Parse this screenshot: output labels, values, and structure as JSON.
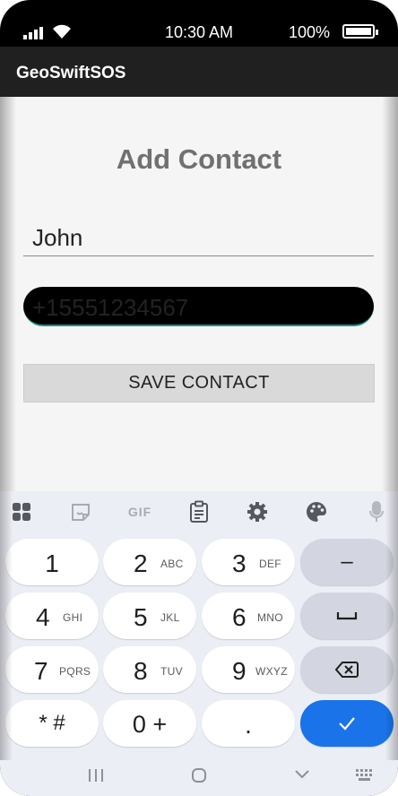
{
  "status_bar": {
    "time": "10:30 AM",
    "battery": "100%"
  },
  "app_bar": {
    "title": "GeoSwiftSOS"
  },
  "form": {
    "heading": "Add Contact",
    "name_value": "John",
    "phone_value": "+15551234567",
    "save_label": "SAVE CONTACT"
  },
  "keyboard": {
    "toolbar": {
      "gif_label": "GIF"
    },
    "keys": {
      "k1": {
        "main": "1",
        "sub": ""
      },
      "k2": {
        "main": "2",
        "sub": "ABC"
      },
      "k3": {
        "main": "3",
        "sub": "DEF"
      },
      "k4": {
        "main": "4",
        "sub": "GHI"
      },
      "k5": {
        "main": "5",
        "sub": "JKL"
      },
      "k6": {
        "main": "6",
        "sub": "MNO"
      },
      "k7": {
        "main": "7",
        "sub": "PQRS"
      },
      "k8": {
        "main": "8",
        "sub": "TUV"
      },
      "k9": {
        "main": "9",
        "sub": "WXYZ"
      },
      "star_hash": "* #",
      "zero_plus": "0 +",
      "dot": ".",
      "minus": "–"
    },
    "accent_color": "#1a73e8"
  },
  "icons": [
    "grid-icon",
    "sticker-icon",
    "clipboard-icon",
    "gear-icon",
    "palette-icon",
    "mic-icon",
    "space-icon",
    "backspace-icon",
    "check-icon",
    "recents-icon",
    "home-icon",
    "back-icon",
    "keyboard-icon"
  ]
}
